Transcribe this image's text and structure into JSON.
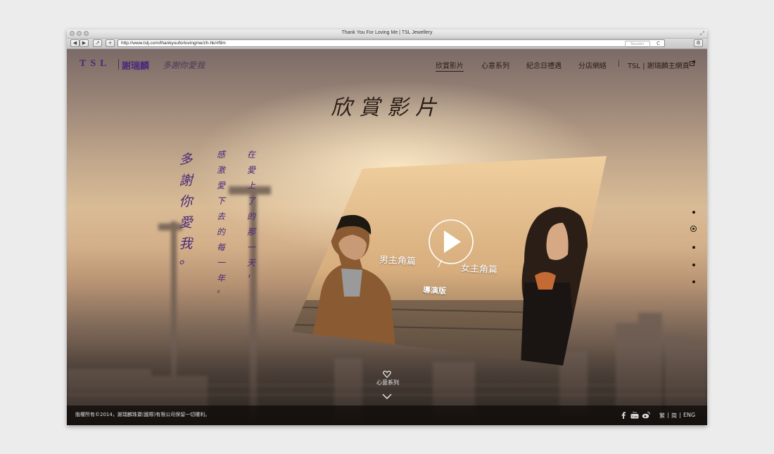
{
  "browser": {
    "window_title": "Thank You For Loving Me | TSL Jewellery",
    "url": "http://www.tslj.com/thankyouforlovingme/zh-hk/#film",
    "reader_label": "Reader",
    "back_glyph": "◀",
    "forward_glyph": "▶",
    "share_glyph": "↗",
    "add_glyph": "+",
    "reload_glyph": "C"
  },
  "header": {
    "logo_brand": "TSL",
    "logo_cn": "謝瑞麟",
    "slogan": "多謝你愛我",
    "nav": [
      {
        "label": "欣賞影片"
      },
      {
        "label": "心意系列"
      },
      {
        "label": "紀念日禮遇"
      },
      {
        "label": "分店網絡"
      },
      {
        "label": "TSL | 謝瑞麟主網頁"
      }
    ],
    "nav_separator": "|",
    "nav_active_index": 0
  },
  "main": {
    "title": "欣賞影片",
    "poem_columns": [
      [
        "多",
        "謝",
        "你",
        "愛",
        "我",
        "。"
      ],
      [
        "感",
        "激",
        "愛",
        "下",
        "去",
        "的",
        "每",
        "一",
        "年",
        "。"
      ],
      [
        "在",
        "愛",
        "上",
        "了",
        "的",
        "那",
        "一",
        "天",
        "，"
      ]
    ],
    "video": {
      "male_label": "男主角篇",
      "separator": "/",
      "female_label": "女主角篇",
      "director_label": "導演版"
    },
    "section_dots": {
      "count": 5,
      "active_index": 1
    },
    "scroll_hint": "心意系列"
  },
  "footer": {
    "copyright": "版權所有©2014，謝瑞麟珠寶(國際)有限公司保留一切權利。",
    "social_icons": [
      "facebook-icon",
      "youtube-icon",
      "weibo-icon"
    ],
    "languages": [
      "繁",
      "简",
      "ENG"
    ],
    "lang_separator": "|"
  },
  "colors": {
    "brand_purple": "#4a2a78",
    "nav_text": "#2a1e18",
    "footer_bg": "#0f0c0a"
  }
}
